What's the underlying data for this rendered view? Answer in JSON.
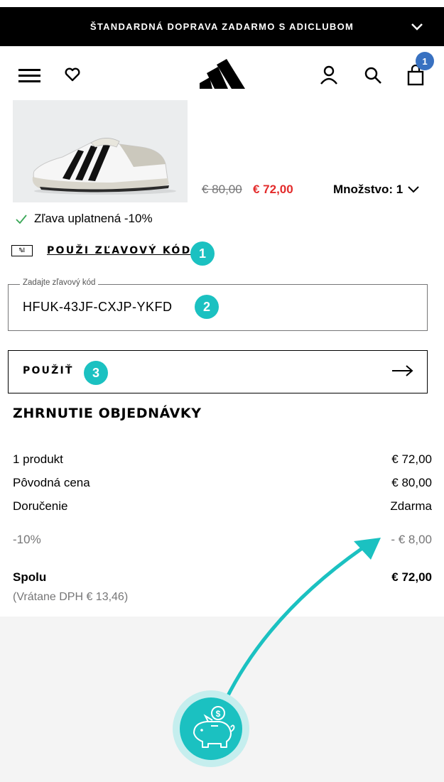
{
  "banner": {
    "text": "ŠTANDARDNÁ DOPRAVA ZADARMO S ADICLUBOM"
  },
  "header": {
    "cart_count": "1"
  },
  "product": {
    "price_old": "€ 80,00",
    "price_new": "€ 72,00",
    "quantity_label": "Množstvo: 1",
    "discount_applied": "Zľava uplatnená -10%"
  },
  "promo": {
    "tag": "%",
    "link_label": "POUŽI ZĽAVOVÝ KÓD",
    "field_label": "Zadajte zľavový kód",
    "field_value": "HFUK-43JF-CXJP-YKFD",
    "apply_label": "POUŽIŤ"
  },
  "steps": [
    "1",
    "2",
    "3"
  ],
  "summary": {
    "title": "ZHRNUTIE OBJEDNÁVKY",
    "rows": [
      {
        "label": "1 produkt",
        "value": "€ 72,00"
      },
      {
        "label": "Pôvodná cena",
        "value": "€ 80,00"
      },
      {
        "label": "Doručenie",
        "value": "Zdarma"
      },
      {
        "label": "-10%",
        "value": "- € 8,00"
      }
    ],
    "total_label": "Spolu",
    "total_value": "€ 72,00",
    "vat": "(Vrátane DPH  € 13,46)"
  },
  "colors": {
    "accent": "#1bc1c1",
    "sale_red": "#e32b2b",
    "badge_blue": "#3871c1"
  }
}
